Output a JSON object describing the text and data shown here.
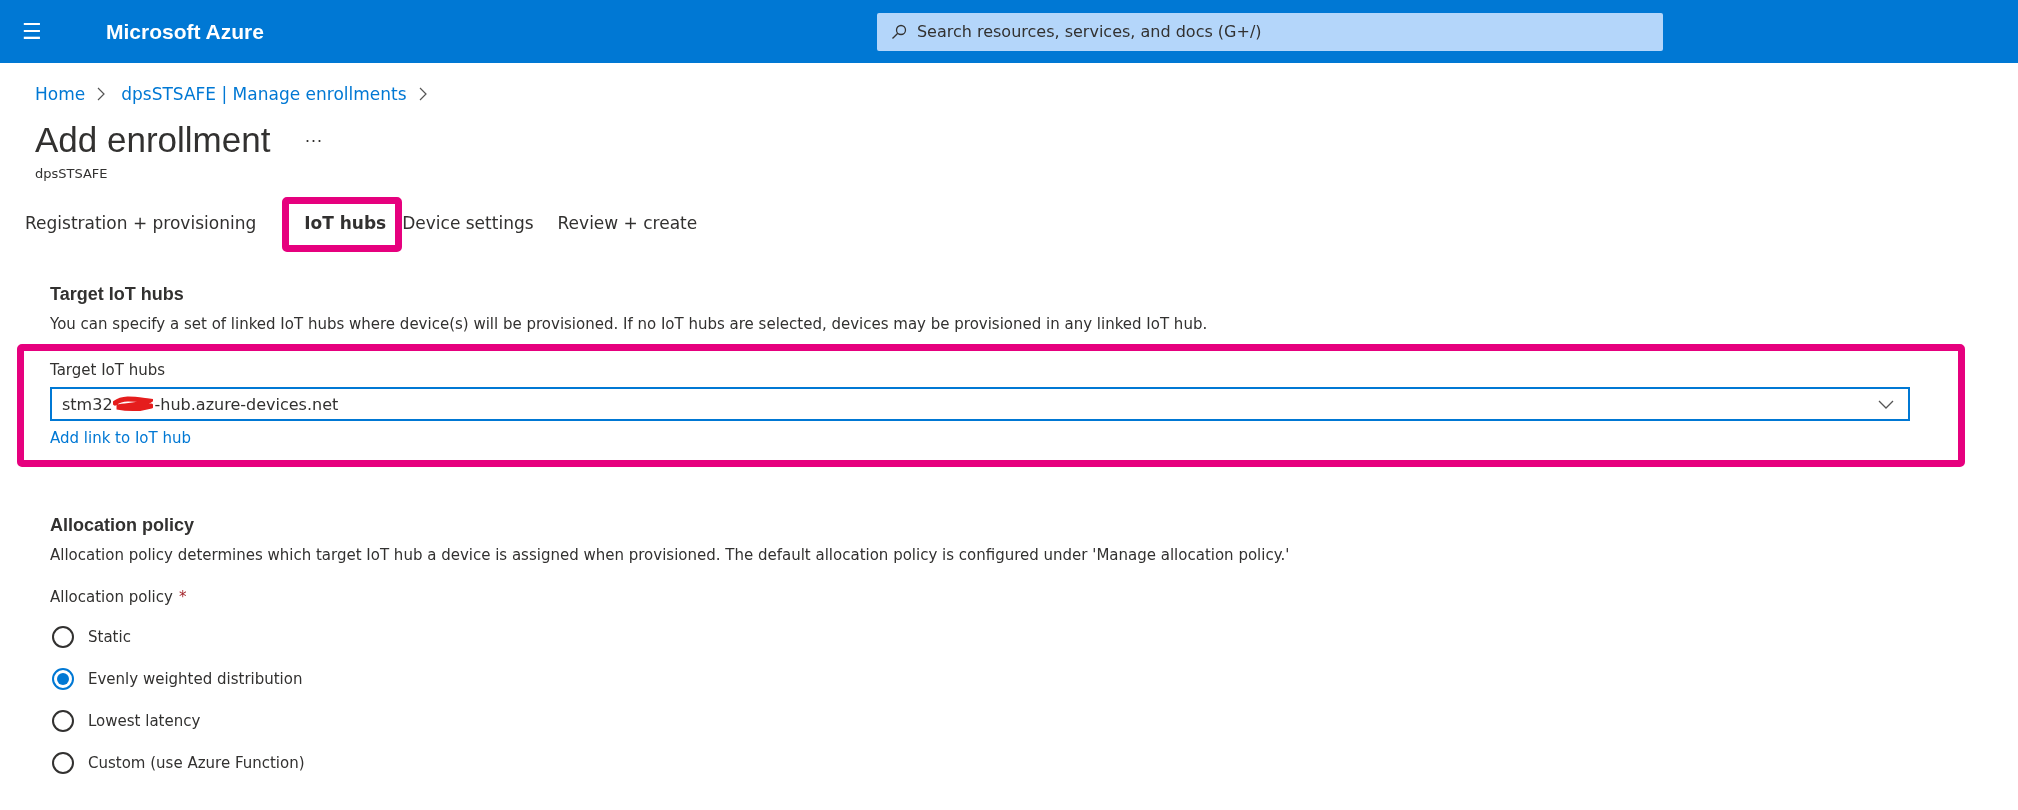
{
  "header": {
    "menu_icon": "☰",
    "brand": "Microsoft Azure",
    "search": {
      "placeholder": "Search resources, services, and docs (G+/)"
    }
  },
  "breadcrumb": [
    {
      "label": "Home"
    },
    {
      "label": "dpsSTSAFE | Manage enrollments"
    }
  ],
  "page": {
    "title": "Add enrollment",
    "more": "···",
    "subtitle": "dpsSTSAFE"
  },
  "tabs": [
    {
      "label": "Registration + provisioning",
      "selected": false,
      "highlighted": false
    },
    {
      "label": "IoT hubs",
      "selected": true,
      "highlighted": true
    },
    {
      "label": "Device settings",
      "selected": false,
      "highlighted": false
    },
    {
      "label": "Review + create",
      "selected": false,
      "highlighted": false
    }
  ],
  "target_hubs": {
    "heading": "Target IoT hubs",
    "description": "You can specify a set of linked IoT hubs where device(s) will be provisioned. If no IoT hubs are selected, devices may be provisioned in any linked IoT hub.",
    "highlighted": true,
    "field": {
      "label": "Target IoT hubs",
      "value_start": "stm32",
      "redacted": true,
      "value_end": "-hub.azure-devices.net"
    },
    "link": "Add link to IoT hub"
  },
  "allocation": {
    "heading": "Allocation policy",
    "description": "Allocation policy determines which target IoT hub a device is assigned when provisioned. The default allocation policy is configured under 'Manage allocation policy.'",
    "label": "Allocation policy",
    "required": "*",
    "options": [
      {
        "label": "Static",
        "selected": false
      },
      {
        "label": "Evenly weighted distribution",
        "selected": true
      },
      {
        "label": "Lowest latency",
        "selected": false
      },
      {
        "label": "Custom (use Azure Function)",
        "selected": false
      }
    ]
  }
}
